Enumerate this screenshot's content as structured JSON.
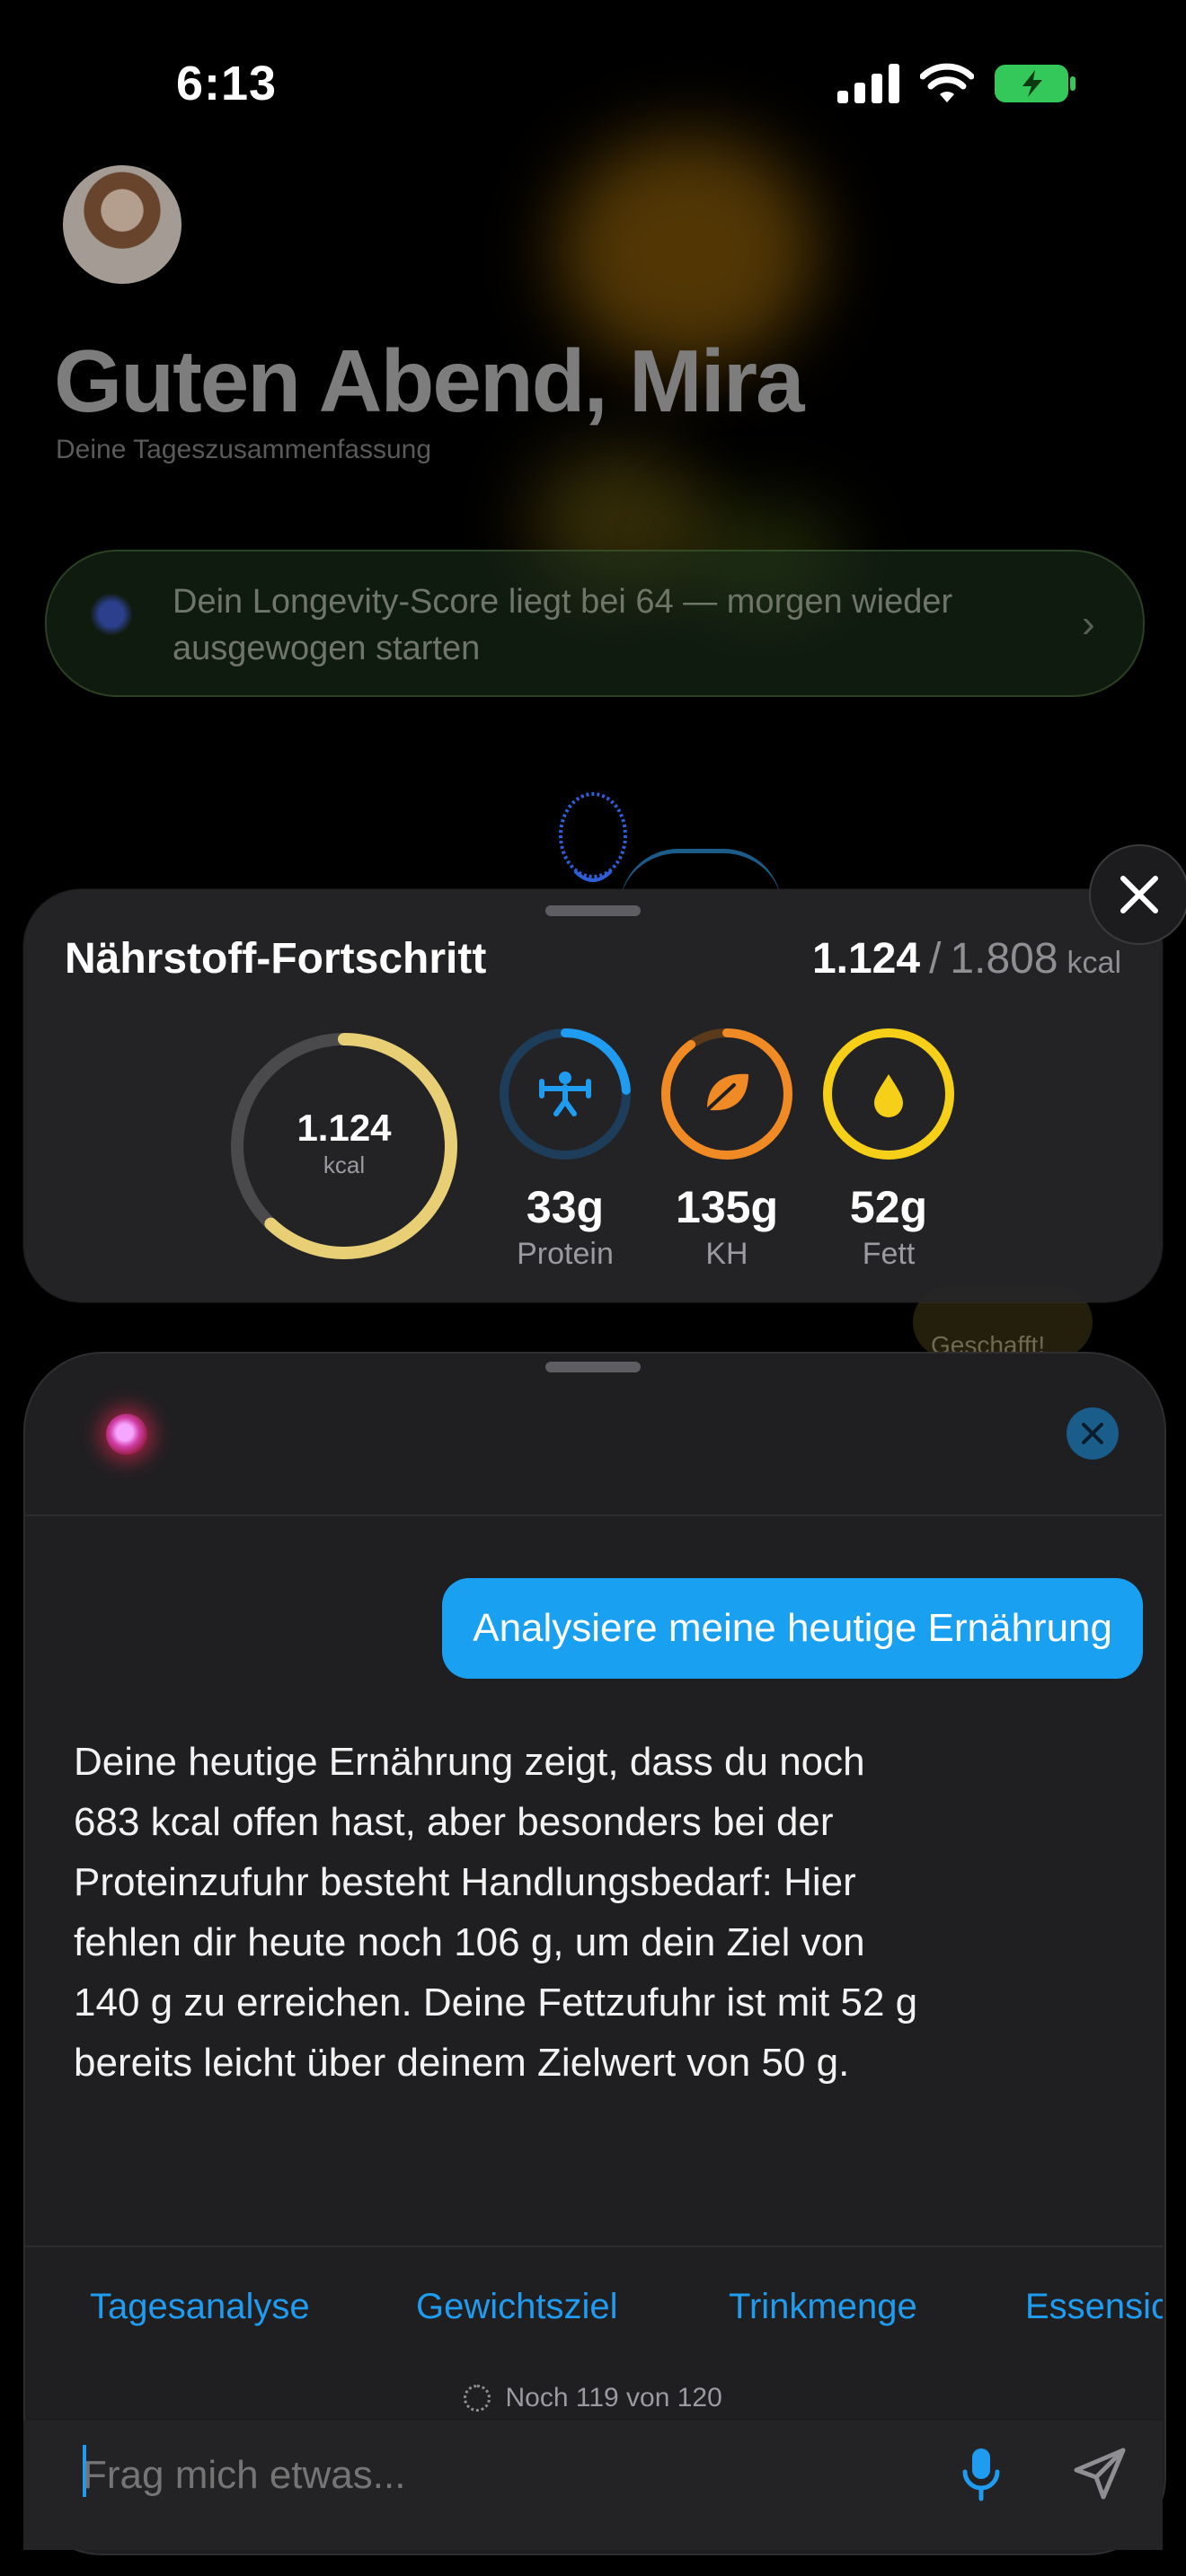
{
  "status_bar": {
    "time": "6:13"
  },
  "header": {
    "greeting": "Guten Abend, Mira",
    "subtitle": "Deine Tageszusammenfassung"
  },
  "banner": {
    "text": "Dein Longevity-Score liegt bei 64 — morgen wieder ausgewogen starten"
  },
  "background": {
    "goal_badge": "Geschafft!"
  },
  "nutrient_card": {
    "title": "Nährstoff-Fortschritt",
    "kcal_current": "1.124",
    "kcal_separator": "/",
    "kcal_goal": "1.808",
    "kcal_unit": "kcal",
    "ring_value": "1.124",
    "ring_unit": "kcal",
    "ring_progress": 0.62,
    "macros": [
      {
        "value": "33g",
        "label": "Protein",
        "color": "#1f9cf0",
        "progress": 0.24,
        "icon": "weightlifter-icon"
      },
      {
        "value": "135g",
        "label": "KH",
        "color": "#f08a24",
        "progress": 0.9,
        "icon": "leaf-icon"
      },
      {
        "value": "52g",
        "label": "Fett",
        "color": "#f5cf18",
        "progress": 1.0,
        "icon": "drop-icon"
      }
    ]
  },
  "chat": {
    "user_message": "Analysiere meine heutige Ernährung",
    "assistant_reply": "Deine heutige Ernährung zeigt, dass du noch 683 kcal offen hast, aber besonders bei der Proteinzufuhr besteht Handlungsbedarf: Hier fehlen dir heute noch 106 g, um dein Ziel von 140 g zu erreichen. Deine Fettzufuhr ist mit 52 g bereits leicht über deinem Zielwert von 50 g.",
    "suggestions": [
      "Tagesanalyse",
      "Gewichtsziel",
      "Trinkmenge",
      "Essensic"
    ],
    "remaining": "Noch 119 von 120",
    "input_placeholder": "Frag mich etwas..."
  },
  "colors": {
    "accent_blue": "#1aa0f0",
    "kcal_ring": "#e8cf76",
    "protein": "#1f9cf0",
    "carbs": "#f08a24",
    "fat": "#f5cf18"
  }
}
